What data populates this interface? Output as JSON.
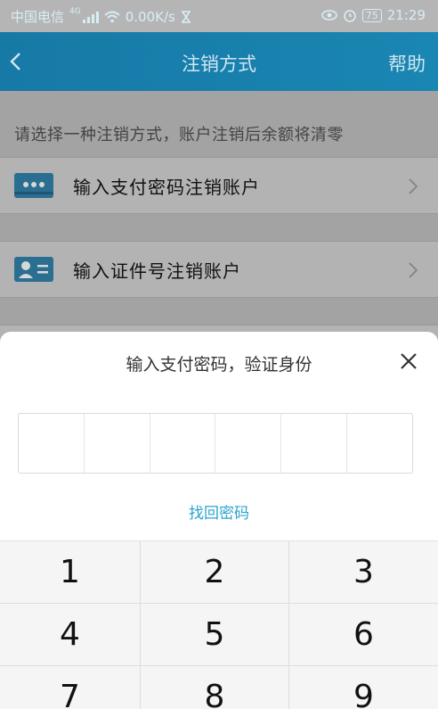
{
  "statusbar": {
    "carrier": "中国电信",
    "network": "4G",
    "speed": "0.00K/s",
    "battery": "75",
    "time": "21:29"
  },
  "header": {
    "title": "注销方式",
    "help": "帮助"
  },
  "content": {
    "tip": "请选择一种注销方式，账户注销后余额将清零",
    "options": [
      {
        "label": "输入支付密码注销账户",
        "icon": "password-card-icon"
      },
      {
        "label": "输入证件号注销账户",
        "icon": "id-card-icon"
      }
    ]
  },
  "sheet": {
    "title": "输入支付密码，验证身份",
    "forgot": "找回密码",
    "keys": [
      "1",
      "2",
      "3",
      "4",
      "5",
      "6",
      "7",
      "8",
      "9"
    ]
  },
  "colors": {
    "header": "#1a86b3",
    "link": "#2aa4cf"
  }
}
